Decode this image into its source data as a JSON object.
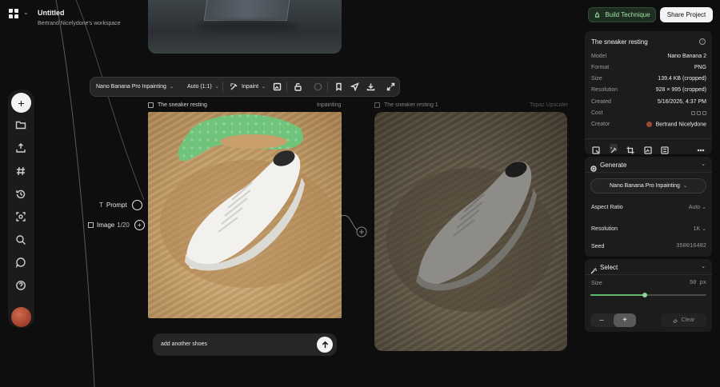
{
  "header": {
    "title": "Untitled",
    "workspace": "Bertrand Nicelydone's workspace"
  },
  "toolbar": {
    "model": "Nano Banana Pro Inpainting",
    "aspect": "Auto (1:1)",
    "mode": "Inpaint"
  },
  "node1": {
    "title": "The sneaker resting",
    "tag": "Inpainting"
  },
  "node2": {
    "title": "The sneaker resting 1",
    "tag": "Topaz Upscaler"
  },
  "ports": {
    "prompt_label": "Prompt",
    "image_label": "Image",
    "image_count": "1/20"
  },
  "prompt": {
    "value": "add another shoes"
  },
  "actions": {
    "build": "Build Technique",
    "share": "Share Project"
  },
  "info": {
    "title": "The sneaker resting",
    "rows": [
      {
        "key": "Model",
        "value": "Nano Banana 2"
      },
      {
        "key": "Format",
        "value": "PNG"
      },
      {
        "key": "Size",
        "value": "139.4 KB (cropped)"
      },
      {
        "key": "Resolution",
        "value": "928 × 995 (cropped)"
      },
      {
        "key": "Created",
        "value": "5/16/2026, 4:37 PM"
      },
      {
        "key": "Cost",
        "value": ""
      },
      {
        "key": "Creator",
        "value": "Bertrand Nicelydone"
      }
    ]
  },
  "generate": {
    "title": "Generate",
    "model": "Nano Banana Pro Inpainting",
    "aspect_label": "Aspect Ratio",
    "aspect_value": "Auto",
    "resolution_label": "Resolution",
    "resolution_value": "1K",
    "seed_label": "Seed",
    "seed_value": "350016402"
  },
  "select": {
    "title": "Select",
    "size_label": "Size",
    "size_value": "50",
    "size_unit": "px",
    "size_level": 0.47,
    "clear": "Clear"
  },
  "colors": {
    "accent_green": "#5fb86b",
    "mask_green": "#6fc37b",
    "background": "#0e0e0e"
  }
}
